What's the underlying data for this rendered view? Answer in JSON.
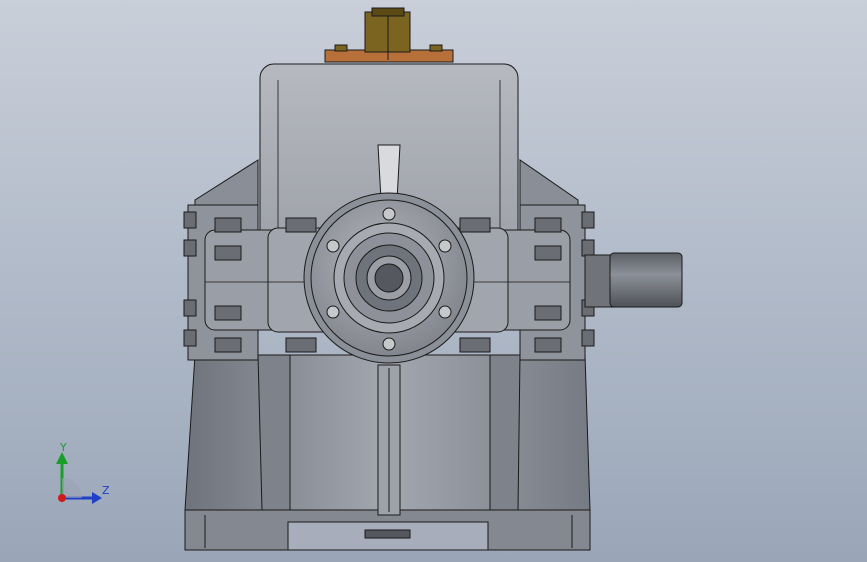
{
  "viewport": {
    "background_top": "#c9cfd9",
    "background_bottom": "#9aa6b8"
  },
  "model": {
    "body_color": "#8d9099",
    "edge_color": "#1a1a1a",
    "top_bracket_color": "#b8703a",
    "cap_color": "#7a6420",
    "shaft_color": "#6f727a"
  },
  "triad": {
    "y_label": "Y",
    "z_label": "Z",
    "y_color": "#1a9e2a",
    "z_color": "#1f3fc7",
    "origin_color": "#d11a1a"
  }
}
